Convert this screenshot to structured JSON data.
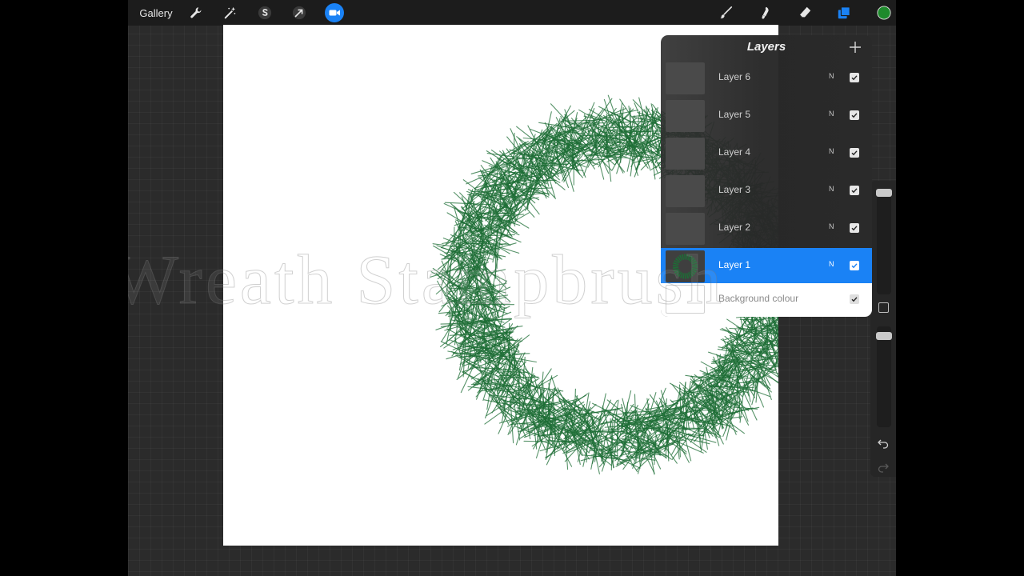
{
  "toolbar": {
    "gallery_label": "Gallery",
    "left_tools": [
      "wrench-icon",
      "magic-wand-icon",
      "selection-s-icon",
      "transform-arrow-icon",
      "video-record-icon"
    ],
    "right_tools": [
      "brush-icon",
      "smudge-icon",
      "eraser-icon",
      "layers-icon",
      "color-swatch-icon"
    ],
    "active_color": "#1e8a2c",
    "accent": "#1a82f5"
  },
  "canvas": {
    "background": "#ffffff",
    "stroke_color": "#1d6e36"
  },
  "watermark": {
    "text": "Wreath Stampbrush"
  },
  "layers_panel": {
    "title": "Layers",
    "layers": [
      {
        "name": "Layer 6",
        "mode": "N",
        "visible": true,
        "active": false
      },
      {
        "name": "Layer 5",
        "mode": "N",
        "visible": true,
        "active": false
      },
      {
        "name": "Layer 4",
        "mode": "N",
        "visible": true,
        "active": false
      },
      {
        "name": "Layer 3",
        "mode": "N",
        "visible": true,
        "active": false
      },
      {
        "name": "Layer 2",
        "mode": "N",
        "visible": true,
        "active": false
      },
      {
        "name": "Layer 1",
        "mode": "N",
        "visible": true,
        "active": true
      }
    ],
    "background_layer": {
      "name": "Background colour",
      "visible": true
    }
  },
  "sidebar": {
    "size_slider": 0.05,
    "opacity_slider": 1.0
  }
}
